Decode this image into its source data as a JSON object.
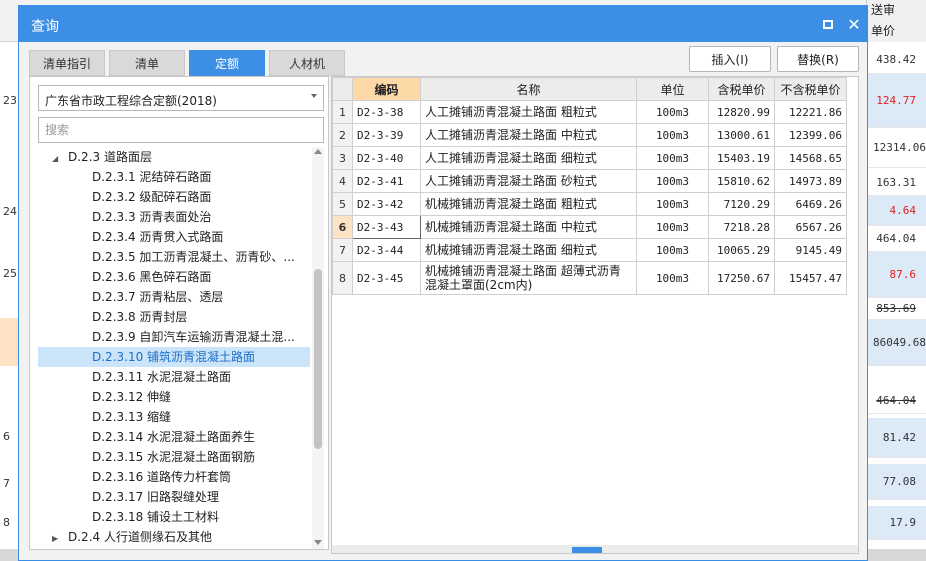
{
  "background": {
    "right_header_1": "送审",
    "right_header_2": "单价",
    "left_rows": [
      "23",
      "24",
      "25",
      "6",
      "7",
      "8"
    ],
    "right_cells": [
      "438.42",
      "124.77",
      "12314.06",
      "163.31",
      "4.64",
      "464.04",
      "87.6",
      "853.69",
      "86049.68",
      "464.04",
      "81.42",
      "77.08",
      "17.9"
    ]
  },
  "dialog": {
    "title": "查询",
    "tabs": [
      "清单指引",
      "清单",
      "定额",
      "人材机"
    ],
    "active_tab_index": 2,
    "insert_button": "插入(I)",
    "replace_button": "替换(R)",
    "quota_library": "广东省市政工程综合定额(2018)",
    "search_placeholder": "搜索",
    "tree": [
      {
        "label": "D.2.3 道路面层",
        "expanded": true
      },
      {
        "label": "D.2.3.1 泥结碎石路面"
      },
      {
        "label": "D.2.3.2 级配碎石路面"
      },
      {
        "label": "D.2.3.3 沥青表面处治"
      },
      {
        "label": "D.2.3.4 沥青贯入式路面"
      },
      {
        "label": "D.2.3.5 加工沥青混凝土、沥青砂、..."
      },
      {
        "label": "D.2.3.6 黑色碎石路面"
      },
      {
        "label": "D.2.3.7 沥青粘层、透层"
      },
      {
        "label": "D.2.3.8 沥青封层"
      },
      {
        "label": "D.2.3.9 自卸汽车运输沥青混凝土混..."
      },
      {
        "label": "D.2.3.10 铺筑沥青混凝土路面",
        "selected": true
      },
      {
        "label": "D.2.3.11 水泥混凝土路面"
      },
      {
        "label": "D.2.3.12 伸缝"
      },
      {
        "label": "D.2.3.13 缩缝"
      },
      {
        "label": "D.2.3.14 水泥混凝土路面养生"
      },
      {
        "label": "D.2.3.15 水泥混凝土路面钢筋"
      },
      {
        "label": "D.2.3.16 道路传力杆套筒"
      },
      {
        "label": "D.2.3.17 旧路裂缝处理"
      },
      {
        "label": "D.2.3.18 铺设土工材料"
      },
      {
        "label": "D.2.4 人行道侧缘石及其他",
        "expanded": false
      }
    ],
    "grid": {
      "headers": [
        "",
        "编码",
        "名称",
        "单位",
        "含税单价",
        "不含税单价"
      ],
      "current_row": 6,
      "rows": [
        [
          "1",
          "D2-3-38",
          "人工摊铺沥青混凝土路面 粗粒式",
          "100m3",
          "12820.99",
          "12221.86"
        ],
        [
          "2",
          "D2-3-39",
          "人工摊铺沥青混凝土路面 中粒式",
          "100m3",
          "13000.61",
          "12399.06"
        ],
        [
          "3",
          "D2-3-40",
          "人工摊铺沥青混凝土路面 细粒式",
          "100m3",
          "15403.19",
          "14568.65"
        ],
        [
          "4",
          "D2-3-41",
          "人工摊铺沥青混凝土路面 砂粒式",
          "100m3",
          "15810.62",
          "14973.89"
        ],
        [
          "5",
          "D2-3-42",
          "机械摊铺沥青混凝土路面 粗粒式",
          "100m3",
          "7120.29",
          "6469.26"
        ],
        [
          "6",
          "D2-3-43",
          "机械摊铺沥青混凝土路面 中粒式",
          "100m3",
          "7218.28",
          "6567.26"
        ],
        [
          "7",
          "D2-3-44",
          "机械摊铺沥青混凝土路面 细粒式",
          "100m3",
          "10065.29",
          "9145.49"
        ],
        [
          "8",
          "D2-3-45",
          "机械摊铺沥青混凝土路面 超薄式沥青混凝土罩面(2cm内)",
          "100m3",
          "17250.67",
          "15457.47"
        ]
      ]
    }
  },
  "colors": {
    "accent": "#3d8fe6",
    "header_highlight": "#fdd9a8",
    "selection": "#cce4fa",
    "negative_red": "#e02020"
  }
}
